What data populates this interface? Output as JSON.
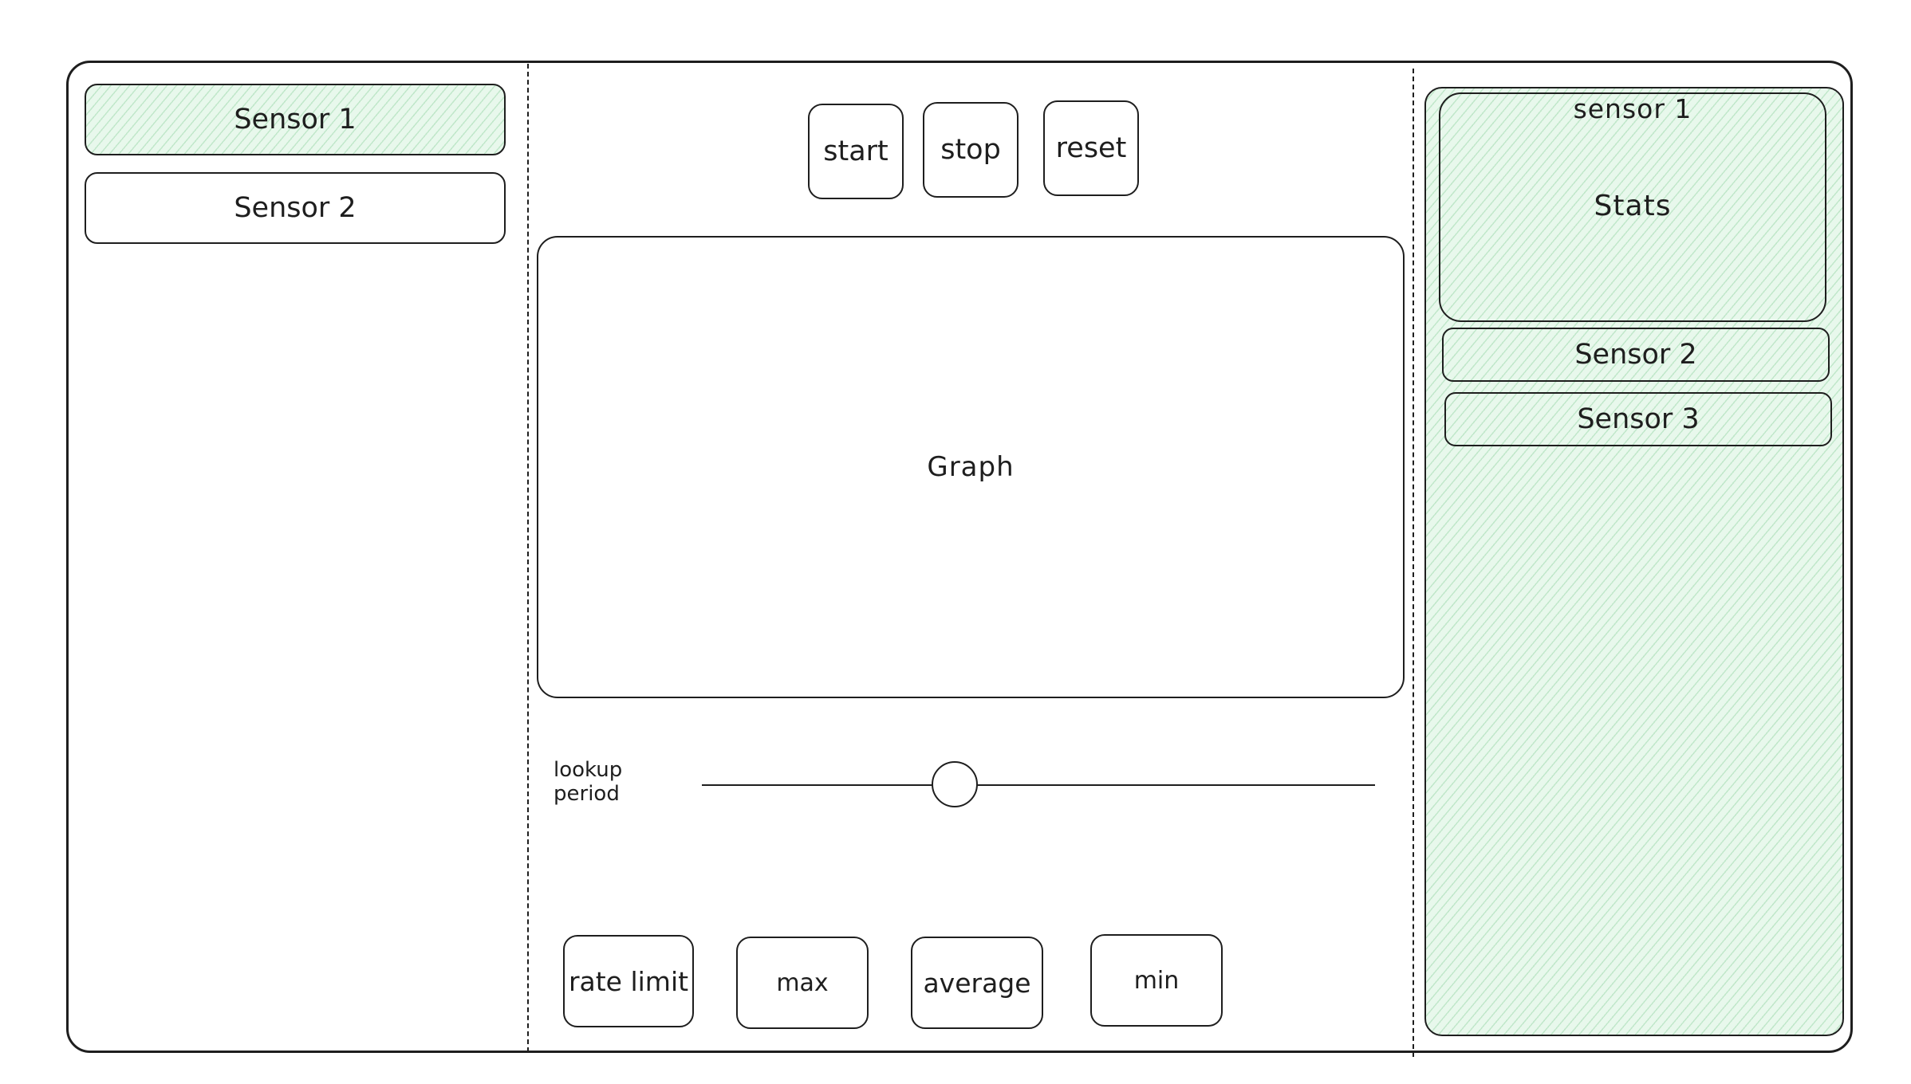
{
  "sidebar": {
    "items": [
      {
        "label": "Sensor 1",
        "selected": true
      },
      {
        "label": "Sensor 2",
        "selected": false
      }
    ]
  },
  "controls": {
    "start_label": "start",
    "stop_label": "stop",
    "reset_label": "reset"
  },
  "graph": {
    "label": "Graph"
  },
  "lookup": {
    "label": "lookup period"
  },
  "actions": {
    "rate_limit_label": "rate limit",
    "max_label": "max",
    "average_label": "average",
    "min_label": "min"
  },
  "stats_panel": {
    "sensor1_label": "sensor 1",
    "stats_label": "Stats",
    "sensor2_label": "Sensor 2",
    "sensor3_label": "Sensor 3"
  },
  "colors": {
    "accent_fill": "#e8f8ec",
    "stroke": "#1e1e1e"
  }
}
